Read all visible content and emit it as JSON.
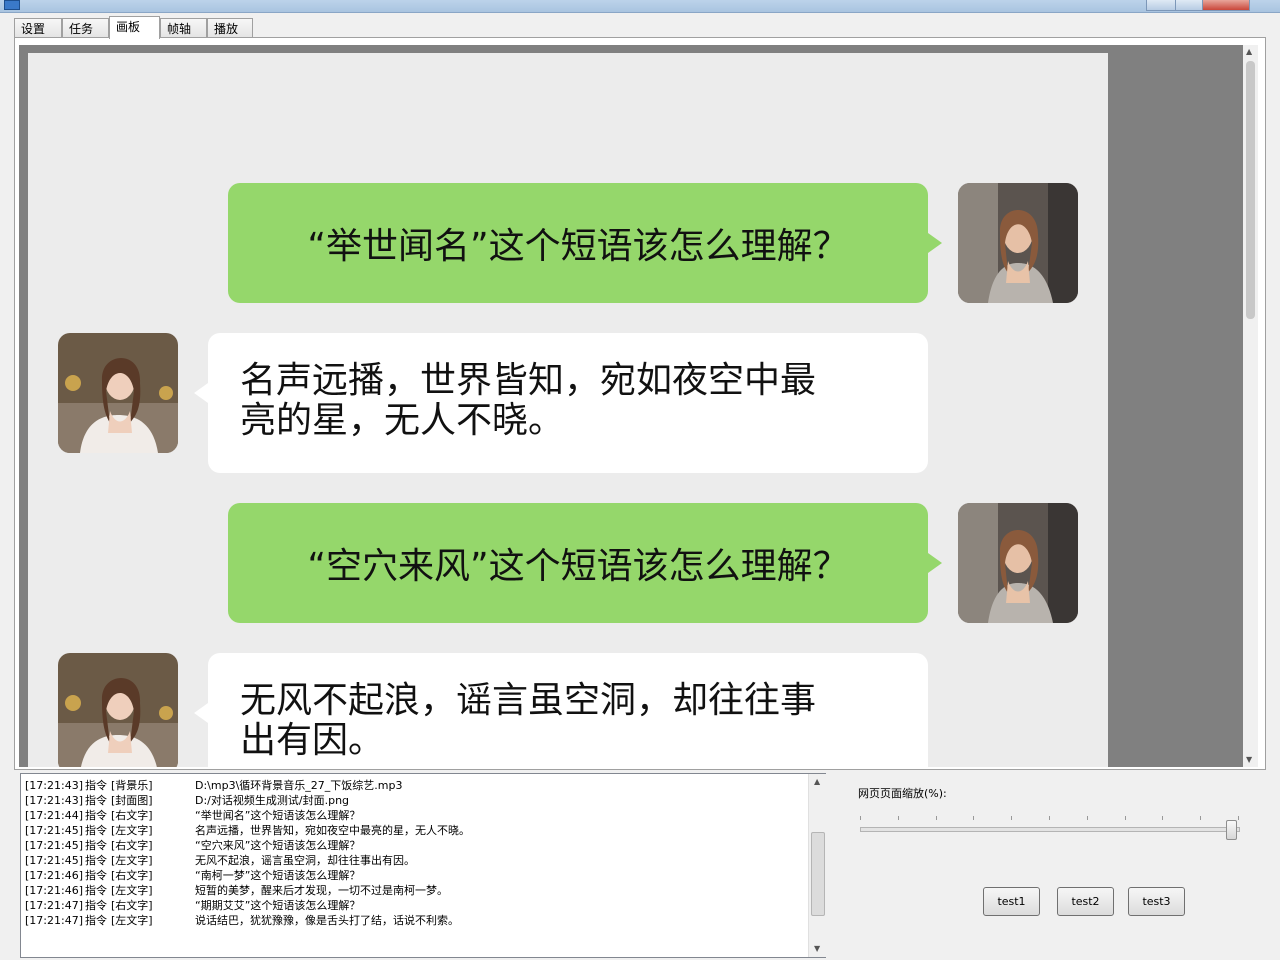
{
  "tabs": [
    {
      "label": "设置"
    },
    {
      "label": "任务"
    },
    {
      "label": "画板",
      "active": true
    },
    {
      "label": "帧轴"
    },
    {
      "label": "播放"
    }
  ],
  "chat": [
    {
      "side": "right",
      "text": "“举世闻名”这个短语该怎么理解？",
      "avatar": "woman-avatar-gray-dress"
    },
    {
      "side": "left",
      "line1": "名声远播，世界皆知，宛如夜空中最",
      "line2": "亮的星，无人不晓。",
      "avatar": "woman-avatar-white-dress"
    },
    {
      "side": "right",
      "text": "“空穴来风”这个短语该怎么理解？",
      "avatar": "woman-avatar-gray-dress"
    },
    {
      "side": "left",
      "line1": "无风不起浪，谣言虽空洞，却往往事",
      "line2": "出有因。",
      "avatar": "woman-avatar-white-dress"
    }
  ],
  "log": [
    {
      "time": "[17:21:43]",
      "cmd": "指令",
      "kind": "[背景乐]",
      "value": "D:\\mp3\\循环背景音乐_27_下饭综艺.mp3"
    },
    {
      "time": "[17:21:43]",
      "cmd": "指令",
      "kind": "[封面图]",
      "value": "D:/对话视频生成测试/封面.png"
    },
    {
      "time": "[17:21:44]",
      "cmd": "指令",
      "kind": "[右文字]",
      "value": "“举世闻名”这个短语该怎么理解？"
    },
    {
      "time": "[17:21:45]",
      "cmd": "指令",
      "kind": "[左文字]",
      "value": "名声远播，世界皆知，宛如夜空中最亮的星，无人不晓。"
    },
    {
      "time": "[17:21:45]",
      "cmd": "指令",
      "kind": "[右文字]",
      "value": "“空穴来风”这个短语该怎么理解？"
    },
    {
      "time": "[17:21:45]",
      "cmd": "指令",
      "kind": "[左文字]",
      "value": "无风不起浪，谣言虽空洞，却往往事出有因。"
    },
    {
      "time": "[17:21:46]",
      "cmd": "指令",
      "kind": "[右文字]",
      "value": "“南柯一梦”这个短语该怎么理解？"
    },
    {
      "time": "[17:21:46]",
      "cmd": "指令",
      "kind": "[左文字]",
      "value": "短暂的美梦，醒来后才发现，一切不过是南柯一梦。"
    },
    {
      "time": "[17:21:47]",
      "cmd": "指令",
      "kind": "[右文字]",
      "value": "“期期艾艾”这个短语该怎么理解？"
    },
    {
      "time": "[17:21:47]",
      "cmd": "指令",
      "kind": "[左文字]",
      "value": "说话结巴，犹犹豫豫，像是舌头打了结，话说不利索。"
    }
  ],
  "zoom": {
    "label": "网页页面缩放(%):",
    "level_fraction": 1.0
  },
  "buttons": [
    {
      "label": "test1"
    },
    {
      "label": "test2"
    },
    {
      "label": "test3"
    }
  ],
  "colors": {
    "bubble_right": "#95d76b",
    "bubble_left": "#ffffff",
    "canvas_bg": "#ececec",
    "viewport_bg": "#808080"
  }
}
